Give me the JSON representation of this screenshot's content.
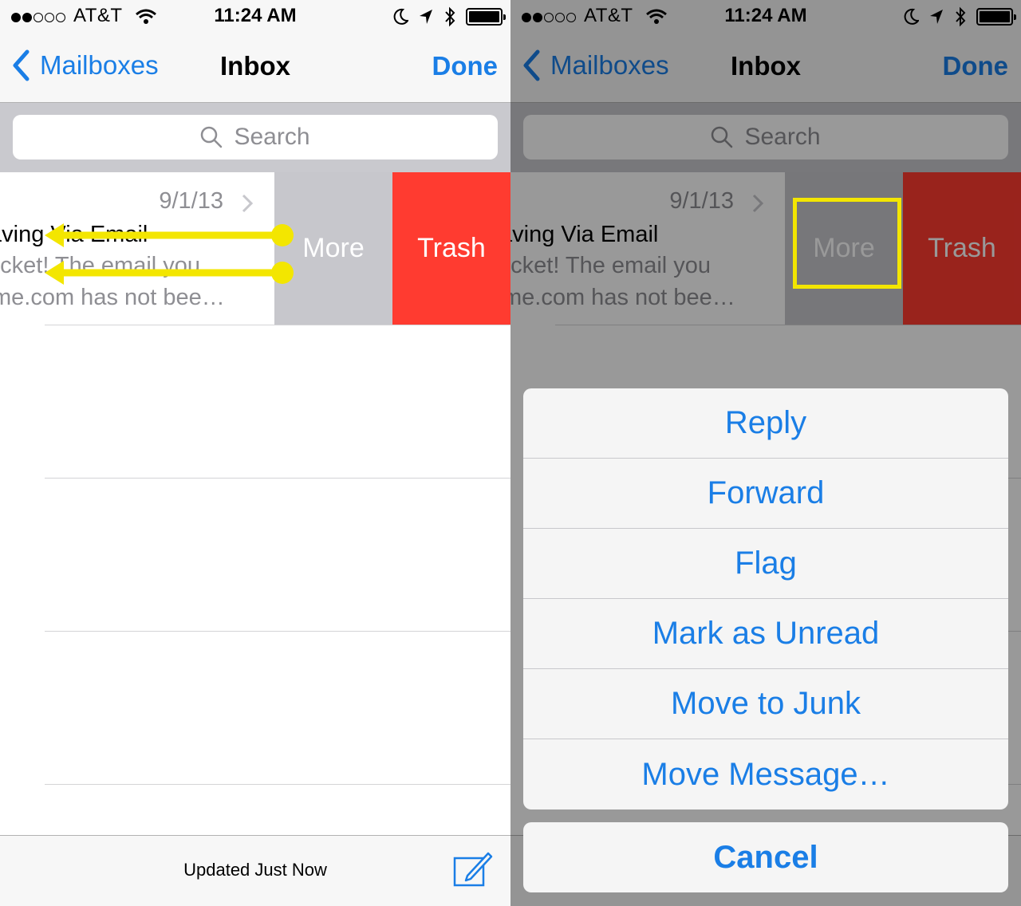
{
  "status": {
    "carrier": "AT&T",
    "time": "11:24 AM",
    "signal_bars": 2,
    "signal_total": 5
  },
  "nav": {
    "back_label": "Mailboxes",
    "title": "Inbox",
    "done_label": "Done"
  },
  "search": {
    "placeholder": "Search"
  },
  "message": {
    "date": "9/1/13",
    "subject": "aving Via Email",
    "preview_line1": "ocket! The email you",
    "preview_line2": "me.com has not bee…"
  },
  "swipe_actions": {
    "more": "More",
    "trash": "Trash"
  },
  "toolbar": {
    "updated": "Updated Just Now"
  },
  "action_sheet": {
    "items": [
      "Reply",
      "Forward",
      "Flag",
      "Mark as Unread",
      "Move to Junk",
      "Move Message…"
    ],
    "cancel": "Cancel"
  },
  "colors": {
    "accent": "#1a7ee6",
    "trash": "#ff3b30",
    "more": "#c7c7cc",
    "annotation": "#f3e600"
  }
}
